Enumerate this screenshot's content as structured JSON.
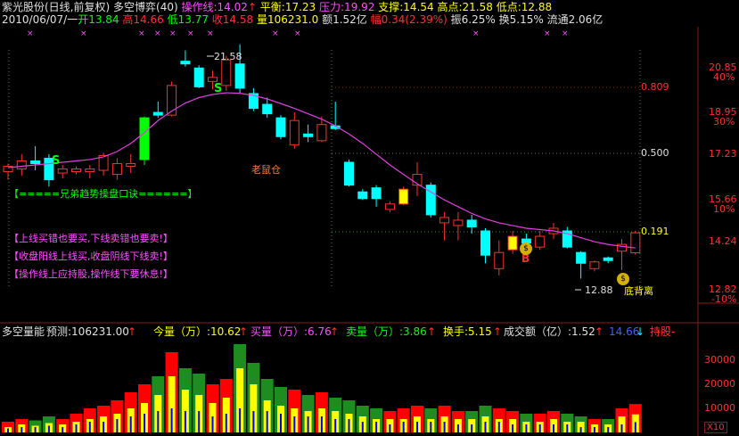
{
  "header": {
    "stock_title": "紫光股份(日线,前复权)",
    "indicator_name": "多空博弈(40)",
    "op_line_label": "操作线:14.02",
    "balance_label": "平衡:17.23",
    "pressure_label": "压力:19.92",
    "support_label": "支撑:14.54",
    "high_point_label": "高点:21.58",
    "low_point_label": "低点:12.88",
    "date": "2010/06/07/一",
    "open_label": "开13.84",
    "high_label": "高14.66",
    "low_label": "低13.77",
    "close_label": "收14.58",
    "volume_label": "量106231.0",
    "amount_label": "额1.52亿",
    "change_label": "幅0.34(2.39%)",
    "amplitude_label": "振6.25%",
    "turnover_label": "换5.15%",
    "float_label": "流通2.06亿"
  },
  "price_axis": {
    "labels": [
      "20.85",
      "40%",
      "18.95",
      "30%",
      "17.23",
      "15.66",
      "10%",
      "14.24",
      "12.82",
      "-10%"
    ]
  },
  "volume_axis": {
    "labels": [
      "30000",
      "20000",
      "10000",
      "X10"
    ]
  },
  "levels": {
    "fib_0809": "0.809",
    "fib_0500": "0.500",
    "fib_0191": "0.191"
  },
  "annotations": {
    "high_mark": "21.58",
    "low_mark": "12.88",
    "signal_s1": "S",
    "signal_s2": "S",
    "signal_b": "B",
    "old_mouse": "老鼠仓",
    "divergence": "底背离"
  },
  "tips": {
    "title": "【=====兄弟趋势操盘口诀======】",
    "line1": "【上线买错也要买,下线卖错也要卖!】",
    "line2": "【收盘阳线上线买,收盘阴线下线卖!】",
    "line3": "【操作线上应持股,操作线下要休息!】"
  },
  "volume_panel": {
    "name": "多空量能",
    "forecast_label": "预测:106231.00",
    "total_label": "今量（万）:10.62",
    "buy_label": "买量（万）:6.76",
    "sell_label": "卖量（万）:3.86",
    "turnover_label": "换手:5.15",
    "amount_label": "成交额（亿）:1.52",
    "price_label": "14.66",
    "hold_label": "持股-"
  },
  "chart_data": {
    "type": "candlestick",
    "ylim": [
      12.3,
      21.9
    ],
    "candles": [
      {
        "o": 16.85,
        "h": 17.15,
        "l": 16.55,
        "c": 17.05
      },
      {
        "o": 16.95,
        "h": 17.5,
        "l": 16.7,
        "c": 17.25
      },
      {
        "o": 17.25,
        "h": 17.8,
        "l": 16.9,
        "c": 17.15
      },
      {
        "o": 17.35,
        "h": 17.5,
        "l": 16.3,
        "c": 16.55
      },
      {
        "o": 16.8,
        "h": 17.1,
        "l": 16.6,
        "c": 16.95
      },
      {
        "o": 16.85,
        "h": 17.05,
        "l": 16.75,
        "c": 16.95
      },
      {
        "o": 16.85,
        "h": 17.1,
        "l": 16.6,
        "c": 16.95
      },
      {
        "o": 16.9,
        "h": 17.55,
        "l": 16.7,
        "c": 17.45
      },
      {
        "o": 16.75,
        "h": 17.35,
        "l": 16.55,
        "c": 17.15
      },
      {
        "o": 17.05,
        "h": 17.5,
        "l": 16.8,
        "c": 17.15
      },
      {
        "o": 17.3,
        "h": 18.9,
        "l": 17.1,
        "c": 18.85
      },
      {
        "o": 19.05,
        "h": 19.45,
        "l": 18.85,
        "c": 18.95
      },
      {
        "o": 18.95,
        "h": 20.2,
        "l": 18.9,
        "c": 20.05
      },
      {
        "o": 20.95,
        "h": 21.35,
        "l": 20.75,
        "c": 20.85
      },
      {
        "o": 20.7,
        "h": 20.8,
        "l": 19.95,
        "c": 20.0
      },
      {
        "o": 20.2,
        "h": 20.6,
        "l": 19.9,
        "c": 20.35
      },
      {
        "o": 20.05,
        "h": 21.15,
        "l": 19.85,
        "c": 21.0
      },
      {
        "o": 20.85,
        "h": 21.58,
        "l": 19.75,
        "c": 19.95
      },
      {
        "o": 19.75,
        "h": 19.95,
        "l": 19.1,
        "c": 19.2
      },
      {
        "o": 19.35,
        "h": 19.6,
        "l": 18.85,
        "c": 19.0
      },
      {
        "o": 18.85,
        "h": 18.95,
        "l": 18.05,
        "c": 18.15
      },
      {
        "o": 17.85,
        "h": 19.05,
        "l": 17.7,
        "c": 18.75
      },
      {
        "o": 18.25,
        "h": 18.6,
        "l": 17.95,
        "c": 18.15
      },
      {
        "o": 18.0,
        "h": 18.9,
        "l": 17.95,
        "c": 18.6
      },
      {
        "o": 18.55,
        "h": 19.45,
        "l": 18.4,
        "c": 18.45
      },
      {
        "o": 17.2,
        "h": 17.3,
        "l": 16.3,
        "c": 16.35
      },
      {
        "o": 16.1,
        "h": 16.2,
        "l": 15.8,
        "c": 15.85
      },
      {
        "o": 16.25,
        "h": 16.35,
        "l": 15.55,
        "c": 15.85
      },
      {
        "o": 15.45,
        "h": 15.75,
        "l": 15.35,
        "c": 15.65
      },
      {
        "o": 15.65,
        "h": 16.3,
        "l": 15.6,
        "c": 16.2
      },
      {
        "o": 16.35,
        "h": 17.2,
        "l": 15.95,
        "c": 16.75
      },
      {
        "o": 16.35,
        "h": 16.45,
        "l": 15.15,
        "c": 15.25
      },
      {
        "o": 14.95,
        "h": 15.35,
        "l": 14.3,
        "c": 15.15
      },
      {
        "o": 14.85,
        "h": 15.35,
        "l": 14.3,
        "c": 15.05
      },
      {
        "o": 15.05,
        "h": 15.25,
        "l": 14.55,
        "c": 14.8
      },
      {
        "o": 14.65,
        "h": 14.75,
        "l": 13.45,
        "c": 13.75
      },
      {
        "o": 13.25,
        "h": 14.3,
        "l": 13.0,
        "c": 13.85
      },
      {
        "o": 13.95,
        "h": 14.65,
        "l": 13.8,
        "c": 14.45
      },
      {
        "o": 14.35,
        "h": 14.55,
        "l": 14.1,
        "c": 14.2
      },
      {
        "o": 14.05,
        "h": 14.65,
        "l": 13.95,
        "c": 14.45
      },
      {
        "o": 14.55,
        "h": 14.95,
        "l": 14.35,
        "c": 14.75
      },
      {
        "o": 14.65,
        "h": 14.8,
        "l": 14.0,
        "c": 14.05
      },
      {
        "o": 13.85,
        "h": 13.9,
        "l": 12.88,
        "c": 13.45
      },
      {
        "o": 13.25,
        "h": 13.55,
        "l": 13.15,
        "c": 13.5
      },
      {
        "o": 13.65,
        "h": 13.7,
        "l": 13.45,
        "c": 13.55
      },
      {
        "o": 13.9,
        "h": 14.35,
        "l": 13.2,
        "c": 14.15
      },
      {
        "o": 13.84,
        "h": 14.66,
        "l": 13.77,
        "c": 14.58
      }
    ],
    "op_line": [
      17.0,
      17.05,
      17.1,
      17.15,
      17.2,
      17.25,
      17.3,
      17.4,
      17.6,
      17.9,
      18.3,
      18.75,
      19.1,
      19.4,
      19.6,
      19.72,
      19.78,
      19.76,
      19.68,
      19.55,
      19.38,
      19.2,
      19.0,
      18.8,
      18.55,
      18.25,
      17.9,
      17.5,
      17.1,
      16.75,
      16.4,
      16.1,
      15.8,
      15.55,
      15.3,
      15.1,
      14.95,
      14.85,
      14.75,
      14.7,
      14.65,
      14.55,
      14.4,
      14.25,
      14.15,
      14.08,
      14.02
    ],
    "volume": [
      {
        "total": 4,
        "buy": 2,
        "sell": 1.5
      },
      {
        "total": 5,
        "buy": 3,
        "sell": 2
      },
      {
        "total": 4.5,
        "buy": 2.5,
        "sell": 2
      },
      {
        "total": 6,
        "buy": 3.5,
        "sell": 2.5
      },
      {
        "total": 5,
        "buy": 3,
        "sell": 2
      },
      {
        "total": 7,
        "buy": 4,
        "sell": 3
      },
      {
        "total": 9,
        "buy": 5,
        "sell": 4
      },
      {
        "total": 10,
        "buy": 6,
        "sell": 4
      },
      {
        "total": 12,
        "buy": 7,
        "sell": 5
      },
      {
        "total": 15,
        "buy": 9,
        "sell": 6
      },
      {
        "total": 18,
        "buy": 11,
        "sell": 7
      },
      {
        "total": 21,
        "buy": 14,
        "sell": 8
      },
      {
        "total": 30,
        "buy": 21,
        "sell": 9
      },
      {
        "total": 24,
        "buy": 16,
        "sell": 8
      },
      {
        "total": 22,
        "buy": 14,
        "sell": 8
      },
      {
        "total": 18,
        "buy": 11,
        "sell": 6
      },
      {
        "total": 20,
        "buy": 13,
        "sell": 7
      },
      {
        "total": 33,
        "buy": 24,
        "sell": 9
      },
      {
        "total": 26,
        "buy": 18,
        "sell": 8
      },
      {
        "total": 20,
        "buy": 12,
        "sell": 8
      },
      {
        "total": 17,
        "buy": 10,
        "sell": 7
      },
      {
        "total": 16,
        "buy": 9,
        "sell": 6
      },
      {
        "total": 14,
        "buy": 8,
        "sell": 6
      },
      {
        "total": 15,
        "buy": 9,
        "sell": 6
      },
      {
        "total": 13,
        "buy": 8,
        "sell": 5
      },
      {
        "total": 12,
        "buy": 7,
        "sell": 5
      },
      {
        "total": 10,
        "buy": 6,
        "sell": 4
      },
      {
        "total": 9,
        "buy": 5,
        "sell": 4
      },
      {
        "total": 8,
        "buy": 5,
        "sell": 3
      },
      {
        "total": 9,
        "buy": 5,
        "sell": 4
      },
      {
        "total": 10,
        "buy": 6,
        "sell": 4
      },
      {
        "total": 9,
        "buy": 5,
        "sell": 4
      },
      {
        "total": 10,
        "buy": 6,
        "sell": 4
      },
      {
        "total": 8,
        "buy": 5,
        "sell": 3
      },
      {
        "total": 8,
        "buy": 5,
        "sell": 3
      },
      {
        "total": 10,
        "buy": 6,
        "sell": 4
      },
      {
        "total": 9,
        "buy": 5,
        "sell": 4
      },
      {
        "total": 8,
        "buy": 5,
        "sell": 3
      },
      {
        "total": 7,
        "buy": 4,
        "sell": 3
      },
      {
        "total": 7,
        "buy": 4,
        "sell": 3
      },
      {
        "total": 8,
        "buy": 5,
        "sell": 3
      },
      {
        "total": 7,
        "buy": 4,
        "sell": 3
      },
      {
        "total": 6,
        "buy": 4,
        "sell": 2
      },
      {
        "total": 5,
        "buy": 3,
        "sell": 2
      },
      {
        "total": 5,
        "buy": 3,
        "sell": 2
      },
      {
        "total": 9,
        "buy": 6,
        "sell": 3
      },
      {
        "total": 10.62,
        "buy": 6.76,
        "sell": 3.86
      }
    ],
    "colors": {
      "up": "#ff3030",
      "down": "#00ffff",
      "up_fill": "#000000",
      "op_line": "#e040e0",
      "green_bar": "#00ff00",
      "yellow_bar": "#ffff00",
      "vol_total_up": "#ff0000",
      "vol_total_down": "#1e8c1e",
      "vol_buy": "#ffff00",
      "vol_sell": "#0000ff"
    }
  }
}
